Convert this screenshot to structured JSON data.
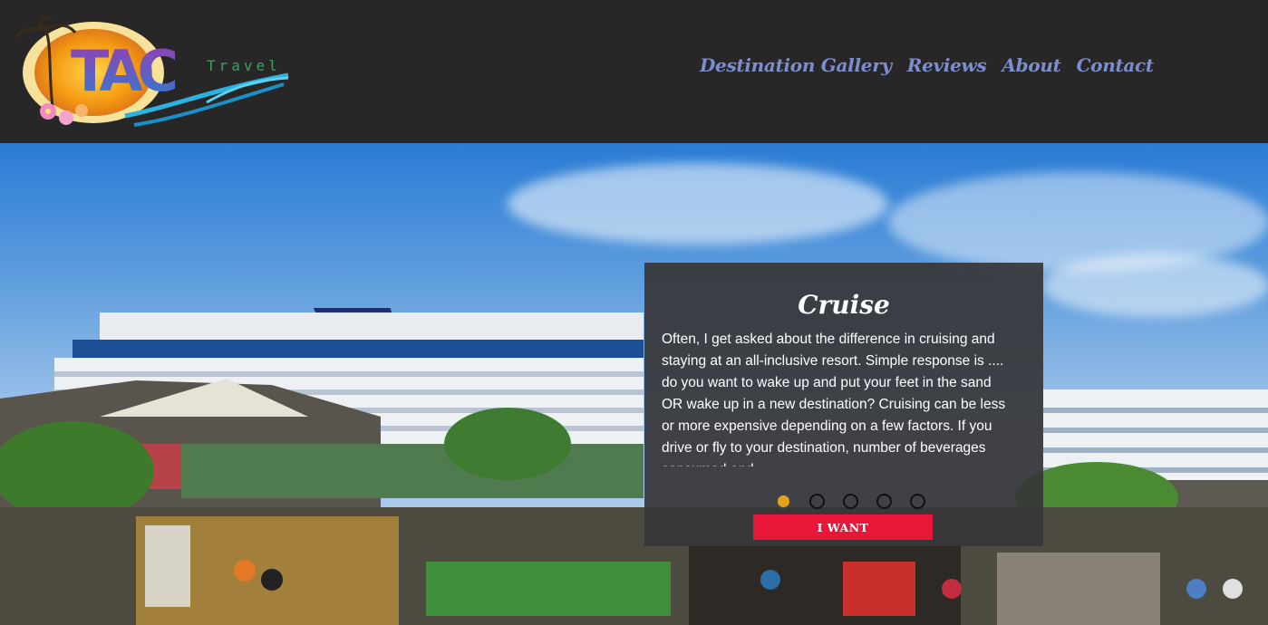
{
  "logo": {
    "text_main": "TAC",
    "text_sub": "Travel"
  },
  "nav": {
    "items": [
      {
        "label": "Destination Gallery"
      },
      {
        "label": "Reviews"
      },
      {
        "label": "About"
      },
      {
        "label": "Contact"
      }
    ]
  },
  "card": {
    "title": "Cruise",
    "body": "Often, I get asked about the difference in cruising and staying at an all-inclusive resort. Simple response is .... do you want to wake up and put your feet in the sand OR wake up in a new destination? Cruising can be less or more expensive depending on a few factors. If you drive or fly to your destination, number of beverages consumed and",
    "button_label": "I WANT",
    "slides_total": 5,
    "active_slide": 1
  },
  "colors": {
    "header_bg": "#282421",
    "nav_link": "#7b8fd0",
    "button_bg": "#e8173a",
    "active_dot": "#e6a21a"
  }
}
